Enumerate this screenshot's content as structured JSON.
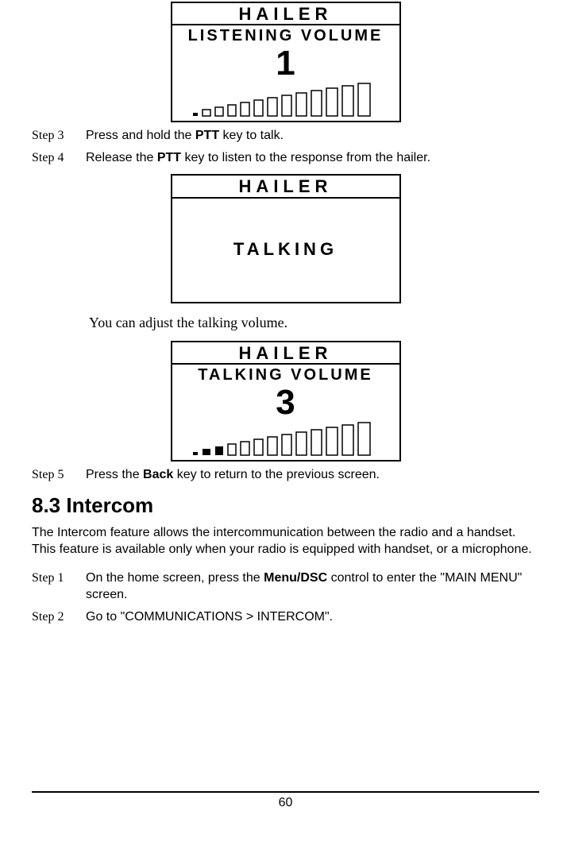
{
  "screen1": {
    "header": "HAILER",
    "line1": "LISTENING VOLUME",
    "value": "1",
    "filled_bars": 1
  },
  "step3": {
    "label": "Step 3",
    "pre": "Press and hold the ",
    "bold": "PTT",
    "post": " key to talk."
  },
  "step4": {
    "label": "Step 4",
    "pre": "Release the ",
    "bold": "PTT",
    "post": " key to listen to the response from the hailer."
  },
  "screen2": {
    "header": "HAILER",
    "status": "TALKING"
  },
  "note": "You can adjust the talking volume.",
  "screen3": {
    "header": "HAILER",
    "line1": "TALKING VOLUME",
    "value": "3",
    "filled_bars": 3
  },
  "step5": {
    "label": "Step 5",
    "pre": "Press the ",
    "bold": "Back",
    "post": " key to return to the previous screen."
  },
  "section": {
    "heading": "8.3 Intercom",
    "para": "The Intercom feature allows the intercommunication between the radio and a handset. This feature is available only when your radio is equipped with handset, or a microphone."
  },
  "stepA": {
    "label": "Step 1",
    "pre": "On the home screen, press the ",
    "bold": "Menu/DSC",
    "post": " control to enter the \"MAIN MENU\" screen."
  },
  "stepB": {
    "label": "Step 2",
    "text": "Go to \"COMMUNICATIONS > INTERCOM\"."
  },
  "page_number": "60"
}
